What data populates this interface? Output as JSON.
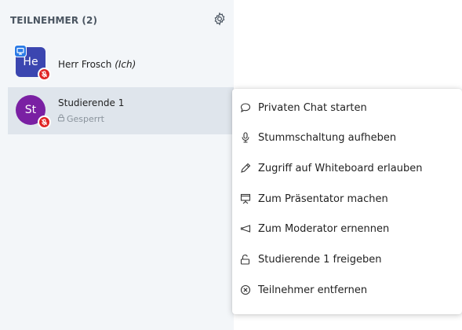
{
  "panel": {
    "title": "TEILNEHMER (2)",
    "settings_icon": "gear-icon"
  },
  "users": [
    {
      "initials": "He",
      "name": "Herr Frosch",
      "you_label": "(Ich)",
      "avatar_color": "#3b46b0",
      "presenter_icon": "presenter-icon",
      "muted_icon": "muted-mic-icon"
    },
    {
      "initials": "St",
      "name": "Studierende 1",
      "status": "Gesperrt",
      "avatar_color": "#7a20a3",
      "muted_icon": "muted-mic-icon",
      "status_icon": "lock-icon"
    }
  ],
  "menu": {
    "items": [
      {
        "label": "Privaten Chat starten",
        "icon": "chat-bubble-icon"
      },
      {
        "label": "Stummschaltung aufheben",
        "icon": "microphone-icon"
      },
      {
        "label": "Zugriff auf Whiteboard erlauben",
        "icon": "pencil-icon"
      },
      {
        "label": "Zum Präsentator machen",
        "icon": "presentation-icon"
      },
      {
        "label": "Zum Moderator ernennen",
        "icon": "megaphone-icon"
      },
      {
        "label": "Studierende 1 freigeben",
        "icon": "unlock-icon"
      },
      {
        "label": "Teilnehmer entfernen",
        "icon": "remove-circle-icon"
      }
    ]
  },
  "colors": {
    "panel_bg": "#f3f6f9",
    "selected_row_bg": "#dfe5ec",
    "muted_badge": "#e02424",
    "presenter_badge": "#2b7be6"
  }
}
